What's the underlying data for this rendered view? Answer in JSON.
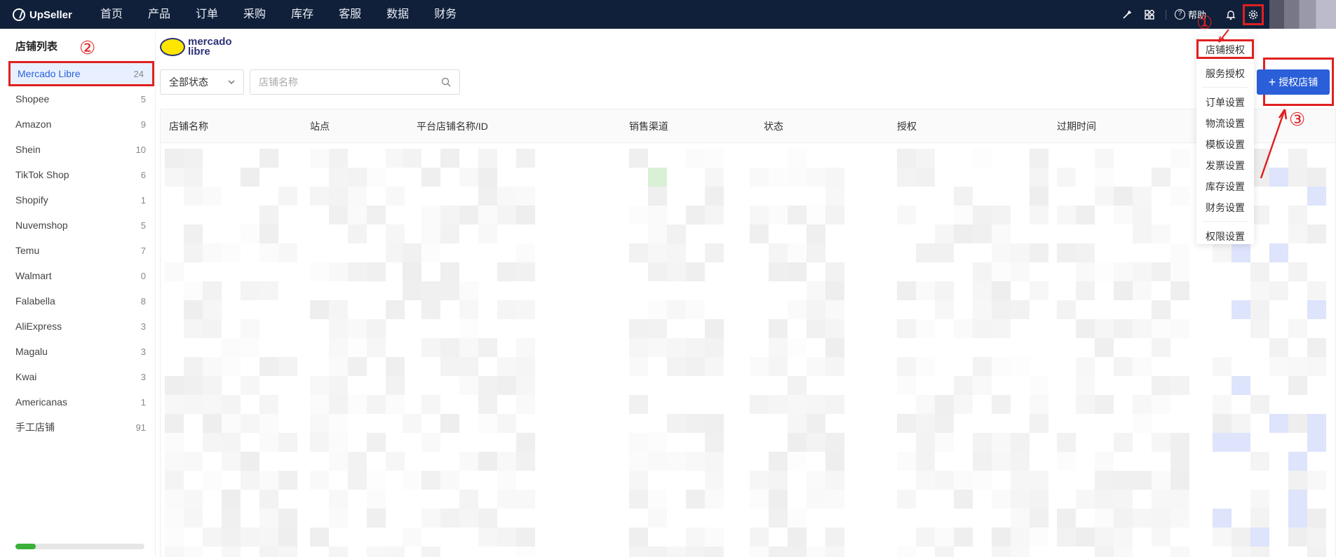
{
  "app": {
    "name": "UpSeller"
  },
  "nav": [
    "首页",
    "产品",
    "订单",
    "采购",
    "库存",
    "客服",
    "数据",
    "财务"
  ],
  "topright": {
    "help_label": "帮助"
  },
  "sidebar": {
    "title": "店铺列表",
    "items": [
      {
        "label": "Mercado Libre",
        "count": "24"
      },
      {
        "label": "Shopee",
        "count": "5"
      },
      {
        "label": "Amazon",
        "count": "9"
      },
      {
        "label": "Shein",
        "count": "10"
      },
      {
        "label": "TikTok Shop",
        "count": "6"
      },
      {
        "label": "Shopify",
        "count": "1"
      },
      {
        "label": "Nuvemshop",
        "count": "5"
      },
      {
        "label": "Temu",
        "count": "7"
      },
      {
        "label": "Walmart",
        "count": "0"
      },
      {
        "label": "Falabella",
        "count": "8"
      },
      {
        "label": "AliExpress",
        "count": "3"
      },
      {
        "label": "Magalu",
        "count": "3"
      },
      {
        "label": "Kwai",
        "count": "3"
      },
      {
        "label": "Americanas",
        "count": "1"
      },
      {
        "label": "手工店铺",
        "count": "91"
      }
    ],
    "progress": 0.16
  },
  "main": {
    "platform_logo": {
      "line1": "mercado",
      "line2": "libre"
    },
    "filter": {
      "value": "全部状态"
    },
    "search": {
      "placeholder": "店铺名称"
    },
    "auth_button": "授权店铺"
  },
  "table": {
    "headers": [
      "店铺名称",
      "站点",
      "平台店铺名称/ID",
      "销售渠道",
      "状态",
      "授权",
      "过期时间"
    ]
  },
  "dropdown": {
    "items": [
      "店铺授权",
      "服务授权",
      "订单设置",
      "物流设置",
      "模板设置",
      "发票设置",
      "库存设置",
      "财务设置",
      "权限设置"
    ]
  },
  "annotations": {
    "one": "①",
    "two": "②",
    "three": "③"
  },
  "colors": {
    "topbar": "#10203a",
    "accent": "#2b5fd9",
    "annotation": "#e02020"
  }
}
